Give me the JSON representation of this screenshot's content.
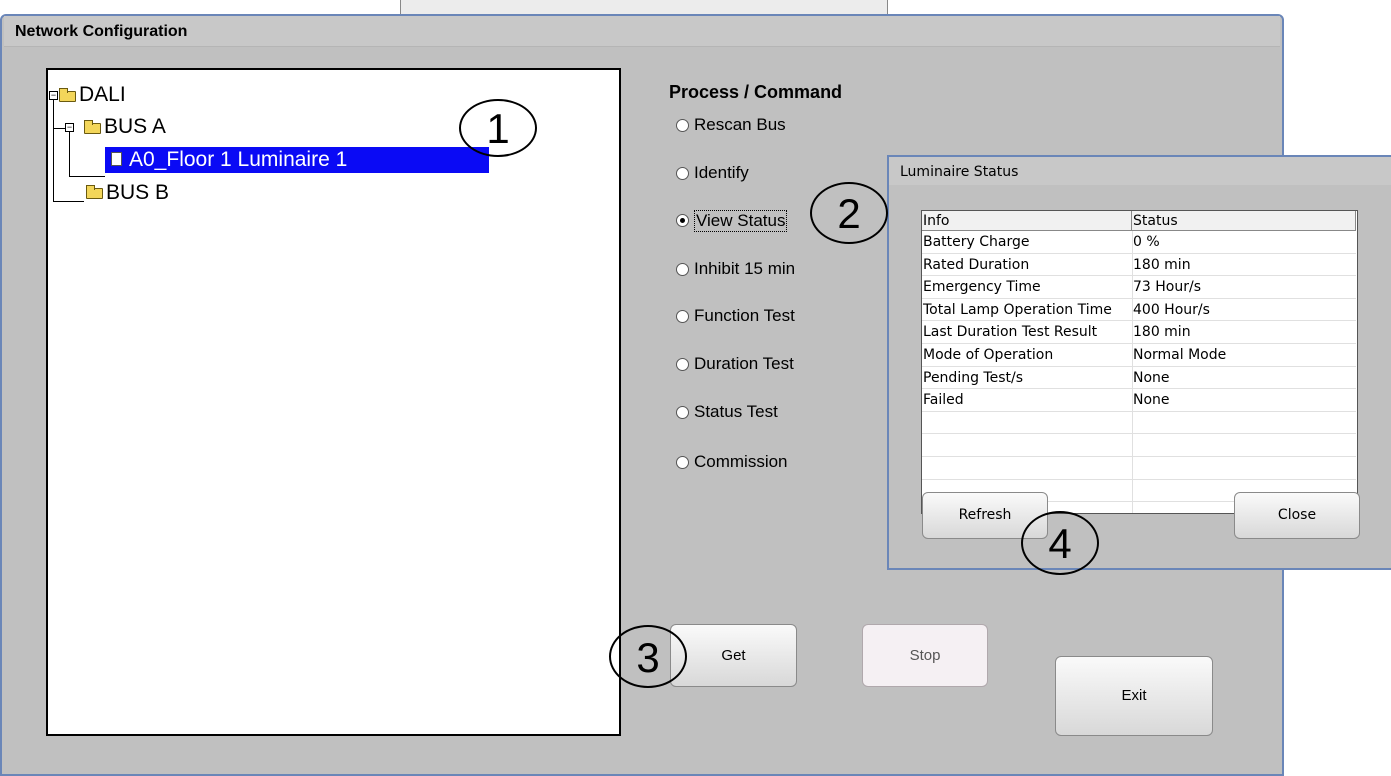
{
  "window": {
    "title": "Network Configuration"
  },
  "tree": {
    "root": "DALI",
    "bus_a": "BUS A",
    "luminaire": "A0_Floor 1 Luminaire 1",
    "bus_b": "BUS B",
    "expand_glyph": "−"
  },
  "process": {
    "title": "Process / Command",
    "options": [
      "Rescan Bus",
      "Identify",
      "View Status",
      "Inhibit 15 min",
      "Function Test",
      "Duration Test",
      "Status Test",
      "Commission"
    ],
    "selected": "View Status"
  },
  "buttons": {
    "get": "Get",
    "stop": "Stop",
    "exit": "Exit"
  },
  "dialog": {
    "title": "Luminaire Status",
    "columns": [
      "Info",
      "Status"
    ],
    "rows": [
      [
        "Battery Charge",
        "0 %"
      ],
      [
        "Rated Duration",
        "180 min"
      ],
      [
        "Emergency Time",
        "73 Hour/s"
      ],
      [
        "Total Lamp Operation Time",
        "400 Hour/s"
      ],
      [
        "Last Duration Test Result",
        "180 min"
      ],
      [
        "Mode of Operation",
        "Normal Mode"
      ],
      [
        "Pending Test/s",
        "None"
      ],
      [
        "Failed",
        "None"
      ]
    ],
    "refresh_label": "Refresh",
    "close_label": "Close"
  },
  "callouts": [
    "1",
    "2",
    "3",
    "4"
  ],
  "colors": {
    "selection": "#0a0af5",
    "window_bg": "#c0c0c0",
    "frame": "#6a86b8"
  }
}
